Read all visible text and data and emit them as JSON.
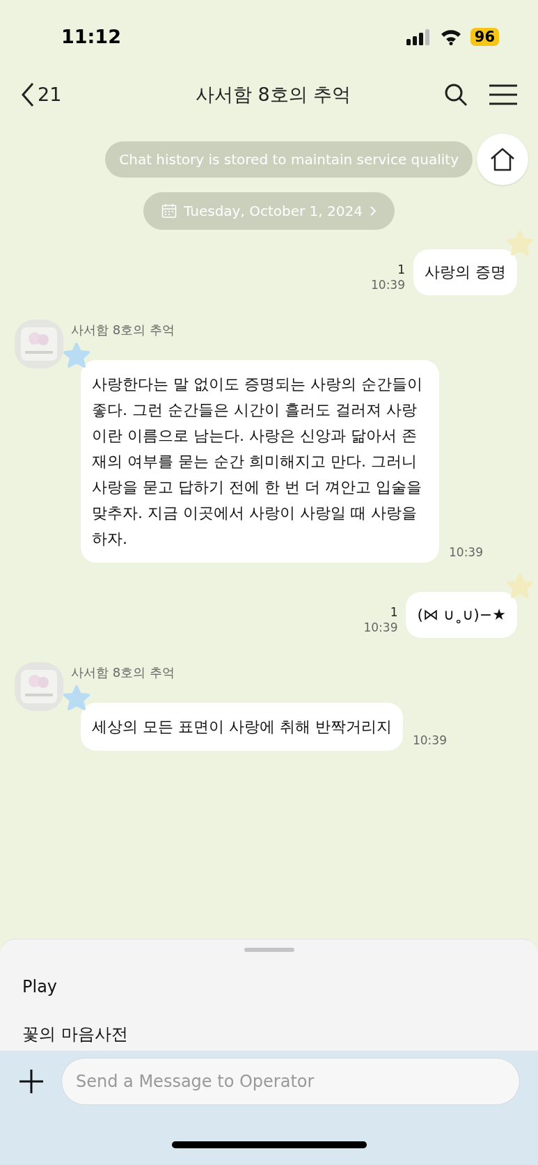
{
  "status_bar": {
    "time": "11:12",
    "battery": "96"
  },
  "header": {
    "back_count": "21",
    "title": "사서함 8호의 추억"
  },
  "notice": "Chat history is stored to maintain service quality",
  "date_chip": "Tuesday, October 1, 2024",
  "messages": [
    {
      "kind": "sent",
      "text": "사랑의 증명",
      "unread": "1",
      "time": "10:39"
    },
    {
      "kind": "received",
      "sender": "사서함 8호의 추억",
      "text": "사랑한다는 말 없이도 증명되는 사랑의 순간들이 좋다. 그런 순간들은 시간이 흘러도 걸러져 사랑이란 이름으로 남는다. 사랑은 신앙과 닮아서 존재의 여부를 묻는 순간 희미해지고 만다. 그러니 사랑을 묻고 답하기 전에 한 번 더 껴안고 입술을 맞추자. 지금 이곳에서 사랑이 사랑일 때 사랑을 하자.",
      "time": "10:39"
    },
    {
      "kind": "sent",
      "text": "(⋈ ∪˳∪)−★",
      "unread": "1",
      "time": "10:39"
    },
    {
      "kind": "received",
      "sender": "사서함 8호의 추억",
      "text": "세상의 모든 표면이 사랑에 취해 반짝거리지",
      "time": "10:39"
    }
  ],
  "sheet_items": [
    "Play",
    "꽃의 마음사전"
  ],
  "composer": {
    "placeholder": "Send a Message to Operator"
  }
}
